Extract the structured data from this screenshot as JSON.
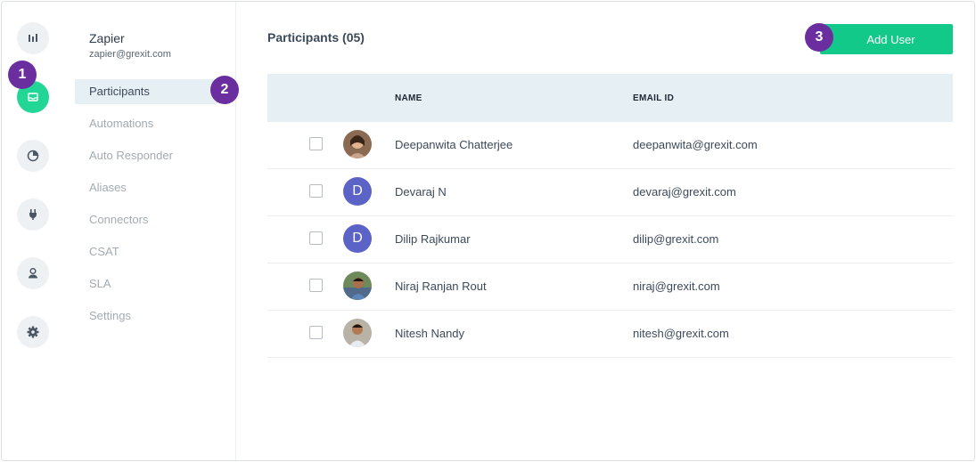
{
  "account": {
    "name": "Zapier",
    "email": "zapier@grexit.com"
  },
  "rail": [
    {
      "icon": "bar-chart-icon",
      "active": false
    },
    {
      "icon": "inbox-icon",
      "active": true
    },
    {
      "icon": "pie-chart-icon",
      "active": false
    },
    {
      "icon": "plug-icon",
      "active": false
    },
    {
      "icon": "user-icon",
      "active": false
    },
    {
      "icon": "gear-icon",
      "active": false
    }
  ],
  "nav": {
    "items": [
      {
        "label": "Participants",
        "active": true
      },
      {
        "label": "Automations"
      },
      {
        "label": "Auto Responder"
      },
      {
        "label": "Aliases"
      },
      {
        "label": "Connectors"
      },
      {
        "label": "CSAT"
      },
      {
        "label": "SLA"
      },
      {
        "label": "Settings"
      }
    ]
  },
  "badges": [
    "1",
    "2",
    "3"
  ],
  "main": {
    "title": "Participants (05)",
    "add_label": "Add User",
    "headers": {
      "name": "NAME",
      "email": "EMAIL ID"
    },
    "rows": [
      {
        "name": "Deepanwita Chatterjee",
        "email": "deepanwita@grexit.com",
        "avatar": "photo",
        "initial": ""
      },
      {
        "name": "Devaraj N",
        "email": "devaraj@grexit.com",
        "avatar": "letter",
        "initial": "D"
      },
      {
        "name": "Dilip Rajkumar",
        "email": "dilip@grexit.com",
        "avatar": "letter",
        "initial": "D"
      },
      {
        "name": "Niraj Ranjan Rout",
        "email": "niraj@grexit.com",
        "avatar": "photo",
        "initial": ""
      },
      {
        "name": "Nitesh Nandy",
        "email": "nitesh@grexit.com",
        "avatar": "photo",
        "initial": ""
      }
    ]
  },
  "colors": {
    "accent": "#13c98a",
    "active_rail": "#22d695",
    "badge": "#6a2e9e",
    "header_bg": "#e6eff4",
    "avatar_letter": "#5c63c6"
  }
}
